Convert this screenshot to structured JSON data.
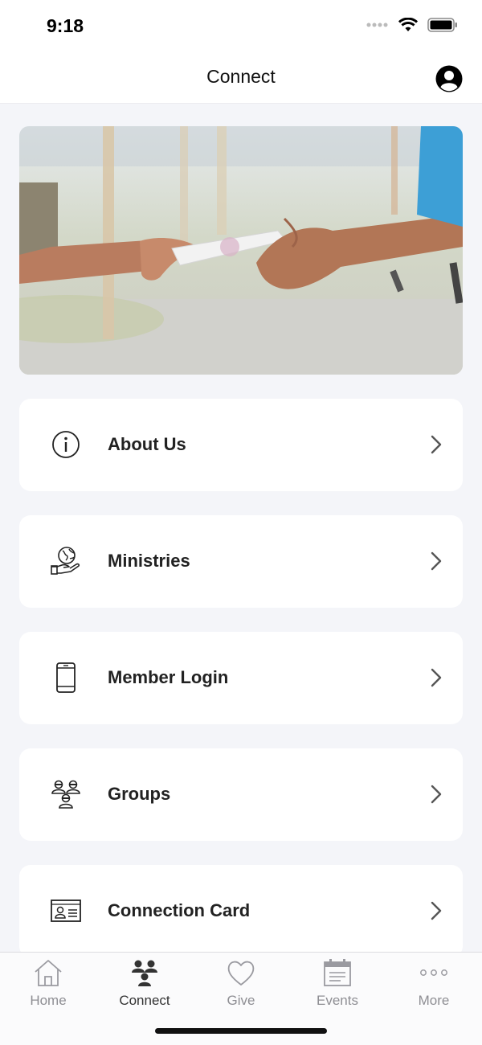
{
  "status": {
    "time": "9:18"
  },
  "nav": {
    "title": "Connect"
  },
  "menu": [
    {
      "label": "About Us",
      "icon": "info-icon"
    },
    {
      "label": "Ministries",
      "icon": "globe-hand-icon"
    },
    {
      "label": "Member Login",
      "icon": "phone-icon"
    },
    {
      "label": "Groups",
      "icon": "group-icon"
    },
    {
      "label": "Connection Card",
      "icon": "id-card-icon"
    }
  ],
  "tabs": [
    {
      "label": "Home",
      "icon": "house-icon",
      "active": false
    },
    {
      "label": "Connect",
      "icon": "people-icon",
      "active": true
    },
    {
      "label": "Give",
      "icon": "heart-icon",
      "active": false
    },
    {
      "label": "Events",
      "icon": "calendar-icon",
      "active": false
    },
    {
      "label": "More",
      "icon": "dots-icon",
      "active": false
    }
  ],
  "colors": {
    "background": "#f4f5f9",
    "card": "#ffffff",
    "inactive_tab": "#8e8e93",
    "active_tab": "#333333"
  }
}
